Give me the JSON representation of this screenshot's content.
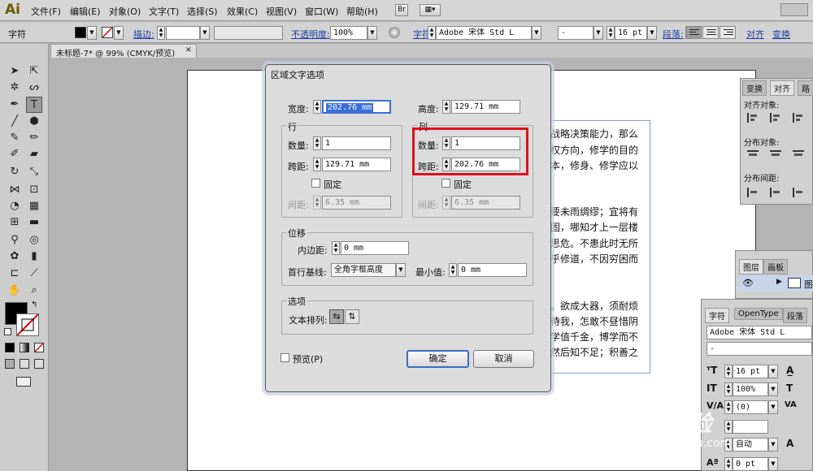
{
  "app": {
    "logo": "Ai"
  },
  "menu": [
    "文件(F)",
    "编辑(E)",
    "对象(O)",
    "文字(T)",
    "选择(S)",
    "效果(C)",
    "视图(V)",
    "窗口(W)",
    "帮助(H)"
  ],
  "menu_icons": {
    "bridge": "Br"
  },
  "control": {
    "tool_name": "字符",
    "stroke_label": "描边:",
    "opacity_label": "不透明度:",
    "opacity_value": "100%",
    "char_label": "字符:",
    "font_value": "Adobe 宋体 Std L",
    "style_value": "-",
    "size_value": "16 pt",
    "para_label": "段落:",
    "align_label": "对齐",
    "transform_label": "变换"
  },
  "document": {
    "tab": "未标题-7* @ 99% (CMYK/预览)"
  },
  "body_text": [
    "战略决策能力，那么",
    "权方向，修学的目的",
    "本，修身、修学应以",
    "要未雨绸缪；宜将有",
    "固，哪知才上一层楼",
    "思危。不患此时无所",
    "乎修道，不因穷困而",
    "。欲成大器，须耐烦",
    "待我，怎敢不昼惜阴",
    "学值千金，博学而不",
    "然后知不足；积善之"
  ],
  "dialog": {
    "title": "区域文字选项",
    "width_label": "宽度:",
    "width_value": "202.76 mm",
    "height_label": "高度:",
    "height_value": "129.71 mm",
    "rows": {
      "title": "行",
      "count_label": "数量:",
      "count_value": "1",
      "span_label": "跨距:",
      "span_value": "129.71 mm",
      "fixed_label": "固定",
      "gutter_label": "间距:",
      "gutter_value": "6.35 mm"
    },
    "cols": {
      "title": "列",
      "count_label": "数量:",
      "count_value": "1",
      "span_label": "跨距:",
      "span_value": "202.76 mm",
      "fixed_label": "固定",
      "gutter_label": "间距:",
      "gutter_value": "6.35 mm"
    },
    "offset": {
      "title": "位移",
      "inset_label": "内边距:",
      "inset_value": "0 mm",
      "baseline_label": "首行基线:",
      "baseline_value": "全角字框高度",
      "min_label": "最小值:",
      "min_value": "0 mm"
    },
    "options": {
      "title": "选项",
      "flow_label": "文本排列:"
    },
    "preview_label": "预览(P)",
    "ok_label": "确定",
    "cancel_label": "取消"
  },
  "align_panel": {
    "tabs": [
      "变换",
      "对齐",
      "路"
    ],
    "align_objects": "对齐对象:",
    "distribute_objects": "分布对象:",
    "distribute_spacing": "分布间距:"
  },
  "layers_panel": {
    "tabs": [
      "图层",
      "画板"
    ],
    "layer_name": "图"
  },
  "char_panel": {
    "tabs": [
      "字符",
      "OpenType",
      "段落"
    ],
    "font": "Adobe 宋体 Std L",
    "style": "-",
    "size": "16 pt",
    "scale": "100%",
    "leading": "(0)",
    "auto": "自动",
    "baseline": "0 pt"
  },
  "watermark": {
    "main": "Bai 经验",
    "sub": "jingyan.baidu.com"
  }
}
